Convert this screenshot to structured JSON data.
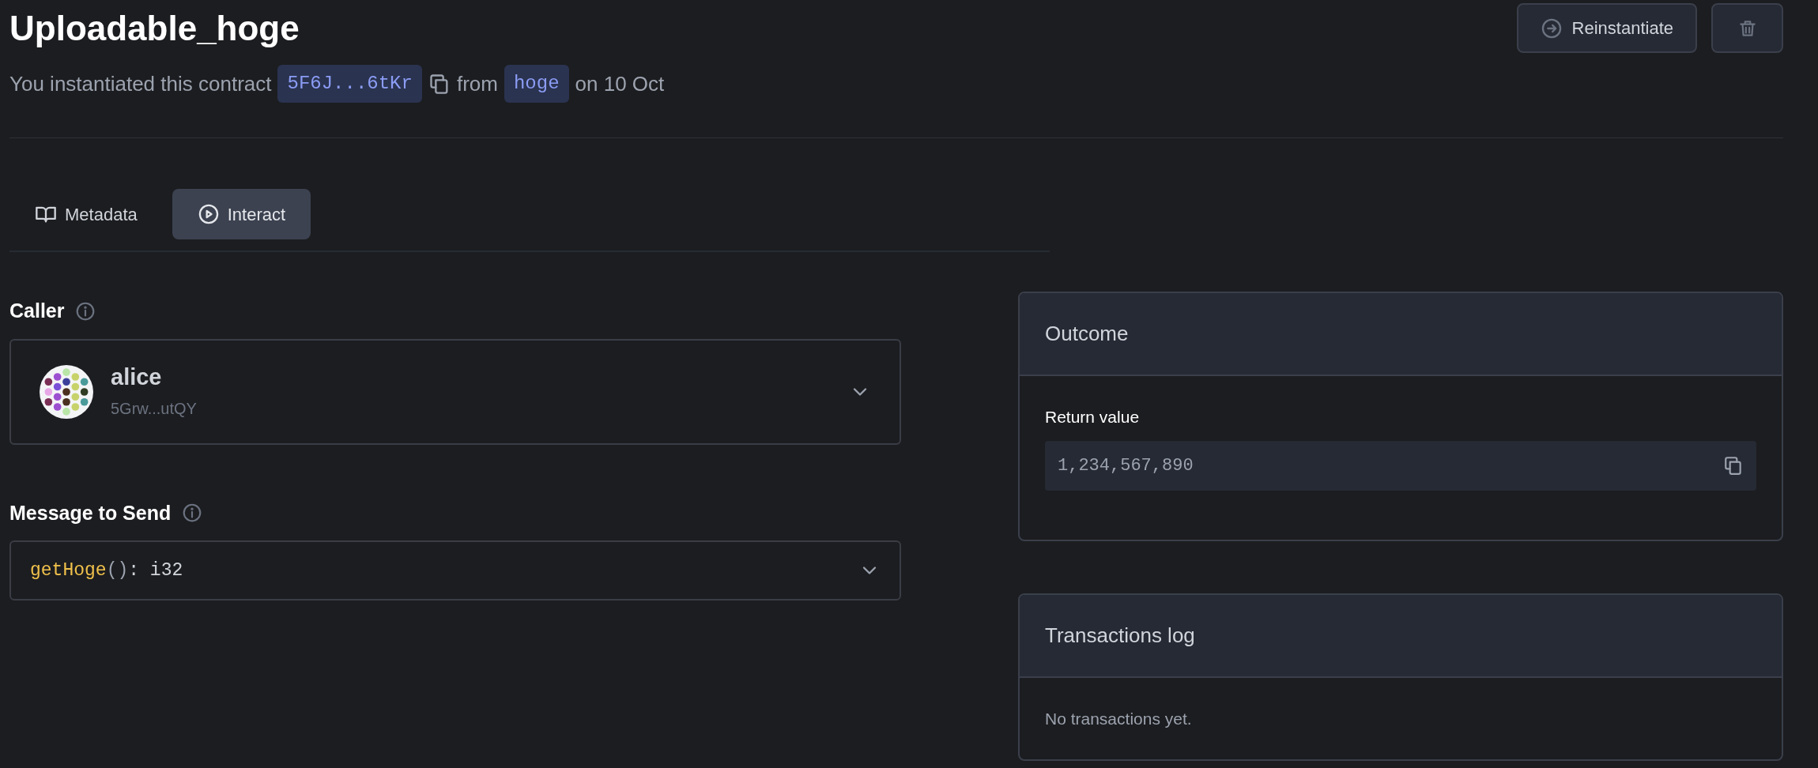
{
  "header": {
    "title": "Uploadable_hoge",
    "subtitle": {
      "prefix": "You instantiated this contract",
      "address": "5F6J...6tKr",
      "from_word": "from",
      "code_name": "hoge",
      "date": "on 10 Oct"
    },
    "buttons": [
      {
        "kind": "reinstantiate",
        "label": "Reinstantiate"
      },
      {
        "kind": "delete"
      }
    ]
  },
  "tabs": [
    {
      "kind": "metadata",
      "label": "Metadata",
      "selected": false
    },
    {
      "kind": "interact",
      "label": "Interact",
      "selected": true
    }
  ],
  "caller": {
    "label": "Caller",
    "name": "alice",
    "address": "5Grw...utQY"
  },
  "message": {
    "label": "Message to Send",
    "method": "getHoge",
    "parens": "()",
    "returns": ": i32"
  },
  "outcome": {
    "title": "Outcome",
    "return_label": "Return value",
    "return_value": "1,234,567,890"
  },
  "transactions": {
    "title": "Transactions log",
    "empty_text": "No transactions yet."
  }
}
